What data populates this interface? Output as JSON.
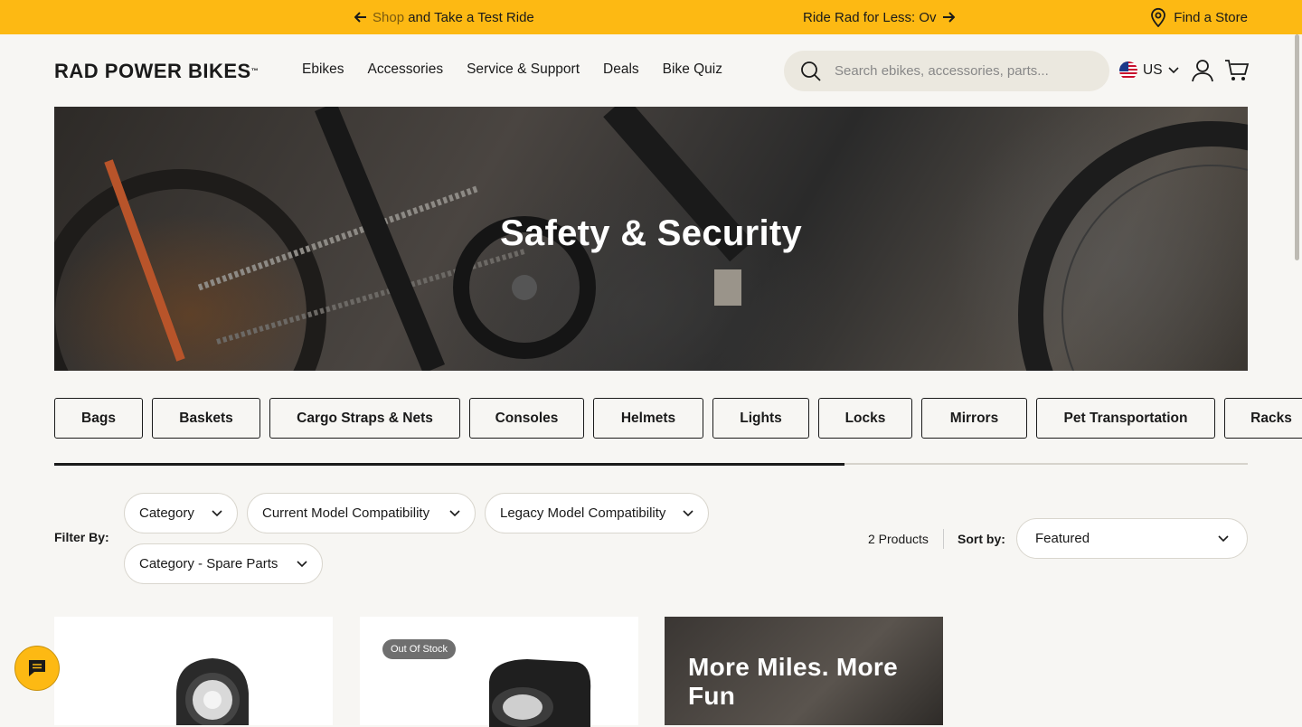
{
  "promo": {
    "message_1_faded": "Shop",
    "message_1": "and Take a Test Ride",
    "message_2": "Ride Rad for Less: Ov",
    "store_link": "Find a Store"
  },
  "header": {
    "logo": "RAD POWER BIKES",
    "logo_tm": "™",
    "nav": [
      "Ebikes",
      "Accessories",
      "Service & Support",
      "Deals",
      "Bike Quiz"
    ],
    "search_placeholder": "Search ebikes, accessories, parts...",
    "locale": "US"
  },
  "hero": {
    "title": "Safety & Security"
  },
  "categories": [
    "Bags",
    "Baskets",
    "Cargo Straps & Nets",
    "Consoles",
    "Helmets",
    "Lights",
    "Locks",
    "Mirrors",
    "Pet Transportation",
    "Racks"
  ],
  "category_scroll_progress": 0.662,
  "filters": {
    "label": "Filter By:",
    "options": [
      "Category",
      "Current Model Compatibility",
      "Legacy Model Compatibility",
      "Category - Spare Parts"
    ]
  },
  "results": {
    "count": "2 Products",
    "sort_label": "Sort by:",
    "sort_value": "Featured"
  },
  "products": [
    {
      "badge": ""
    },
    {
      "badge": "Out Of Stock"
    }
  ],
  "promo_card": {
    "text": "More Miles. More Fun"
  },
  "colors": {
    "accent": "#fdb913",
    "text": "#1a1a1a",
    "background": "#f7f6f3"
  }
}
